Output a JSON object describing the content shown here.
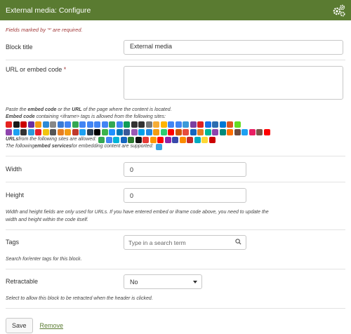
{
  "header": {
    "title": "External media: Configure",
    "icon": "gears-icon"
  },
  "required_note": "Fields marked by '*' are required.",
  "block_title": {
    "label": "Block title",
    "value": "External media"
  },
  "url_embed": {
    "label": "URL or embed code",
    "required_mark": "*",
    "value": ""
  },
  "help": {
    "paste_1": "Paste the ",
    "paste_b1": "embed code",
    "paste_2": " or the ",
    "paste_b2": "URL",
    "paste_3": " of the page where the content is located.",
    "embed_b": "Embed code",
    "embed_rest": " containing <iframe> tags is allowed from the following sites:",
    "urls_b": "URLs",
    "urls_rest": " from the following sites are allowed:",
    "services_1": "The following ",
    "services_b": "embed services",
    "services_2": " for embedding content are supported:"
  },
  "icon_colors": {
    "row1": [
      "#e6231f",
      "#1a1a1a",
      "#c00",
      "#6b2fa0",
      "#f39c12",
      "#2c8ad6",
      "#888",
      "#3a7bd5",
      "#4285f4",
      "#34a853",
      "#4285f4",
      "#4285f4",
      "#4285f4",
      "#4285f4",
      "#34a853",
      "#4285f4",
      "#0f9d58",
      "#333",
      "#333",
      "#777",
      "#f6ad37",
      "#ffb400",
      "#4285f4",
      "#4285f4",
      "#3b9ad9",
      "#7b3fa0",
      "#d22",
      "#1a73e8",
      "#2b6cb0",
      "#0078d4",
      "#d52",
      "#6d2"
    ],
    "row2": [
      "#8e44ad",
      "#1da1f2",
      "#333",
      "#2d9cdb",
      "#e61e2b",
      "#f1c40f",
      "#555",
      "#e67e22",
      "#f39c12",
      "#c0392b",
      "#1da1f2",
      "#2d3e50",
      "#000",
      "#3bb34a",
      "#1e90ff",
      "#0077b5",
      "#3b5998",
      "#9b59b6",
      "#00a0e9",
      "#1e88e5",
      "#f39c12",
      "#2ecc71",
      "#ff0000",
      "#d35400",
      "#e74c3c",
      "#1565c0",
      "#e67e22",
      "#00b894",
      "#8e44ad",
      "#00897b",
      "#ff6f00",
      "#6d4c41",
      "#1da1f2",
      "#e91e63",
      "#795548",
      "#ff0000"
    ],
    "row3": [
      "#34a853",
      "#4285f4",
      "#00b4d8",
      "#1565c0",
      "#2e7d32",
      "#111",
      "#e53935",
      "#ff9800",
      "#ff0000",
      "#8e24aa",
      "#3949ab",
      "#fb8c00",
      "#c62828",
      "#00acc1",
      "#fdd835",
      "#c00"
    ],
    "row4": [
      "#3aa3e3"
    ]
  },
  "width": {
    "label": "Width",
    "value": "0"
  },
  "height": {
    "label": "Height",
    "value": "0"
  },
  "size_help": "Width and height fields are only used for URLs. If you have entered embed or iframe code above, you need to update the width and height within the code itself.",
  "tags": {
    "label": "Tags",
    "placeholder": "Type in a search term",
    "help": "Search for/enter tags for this block.",
    "icon": "search-icon"
  },
  "retractable": {
    "label": "Retractable",
    "value": "No",
    "help": "Select to allow this block to be retracted when the header is clicked."
  },
  "actions": {
    "save": "Save",
    "remove": "Remove"
  }
}
